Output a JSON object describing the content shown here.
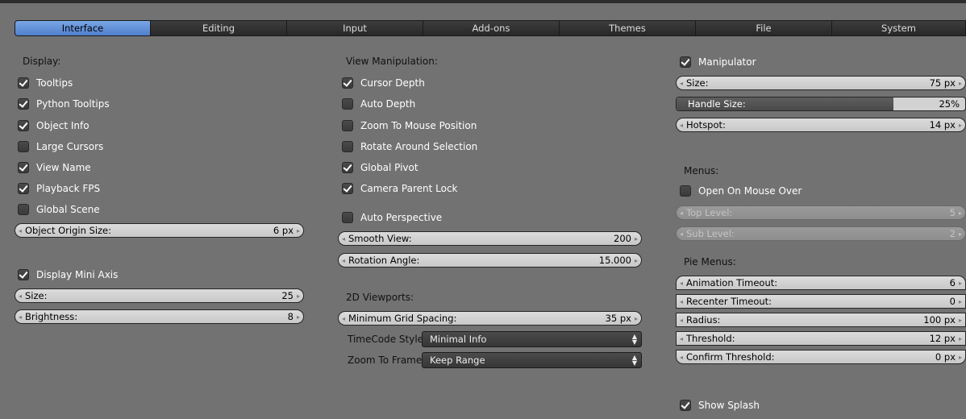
{
  "tabs": [
    "Interface",
    "Editing",
    "Input",
    "Add-ons",
    "Themes",
    "File",
    "System"
  ],
  "active_tab": "Interface",
  "col1": {
    "display_header": "Display:",
    "tooltips": "Tooltips",
    "python_tooltips": "Python Tooltips",
    "object_info": "Object Info",
    "large_cursors": "Large Cursors",
    "view_name": "View Name",
    "playback_fps": "Playback FPS",
    "global_scene": "Global Scene",
    "object_origin_size": {
      "label": "Object Origin Size:",
      "value": "6 px"
    },
    "display_mini_axis": "Display Mini Axis",
    "size": {
      "label": "Size:",
      "value": "25"
    },
    "brightness": {
      "label": "Brightness:",
      "value": "8"
    }
  },
  "col2": {
    "view_manip_header": "View Manipulation:",
    "cursor_depth": "Cursor Depth",
    "auto_depth": "Auto Depth",
    "zoom_to_mouse": "Zoom To Mouse Position",
    "rotate_around_selection": "Rotate Around Selection",
    "global_pivot": "Global Pivot",
    "camera_parent_lock": "Camera Parent Lock",
    "auto_perspective": "Auto Perspective",
    "smooth_view": {
      "label": "Smooth View:",
      "value": "200"
    },
    "rotation_angle": {
      "label": "Rotation Angle:",
      "value": "15.000"
    },
    "viewports_header": "2D Viewports:",
    "min_grid_spacing": {
      "label": "Minimum Grid Spacing:",
      "value": "35 px"
    },
    "timecode_label": "TimeCode Style:",
    "timecode_value": "Minimal Info",
    "zoom_frame_label": "Zoom To Frame ...",
    "zoom_frame_value": "Keep Range"
  },
  "col3": {
    "manipulator": "Manipulator",
    "size": {
      "label": "Size:",
      "value": "75 px"
    },
    "handle_size": {
      "label": "Handle Size:",
      "value": "25%",
      "fraction": 0.25
    },
    "hotspot": {
      "label": "Hotspot:",
      "value": "14 px"
    },
    "menus_header": "Menus:",
    "open_on_mouse_over": "Open On Mouse Over",
    "top_level": {
      "label": "Top Level:",
      "value": "5"
    },
    "sub_level": {
      "label": "Sub Level:",
      "value": "2"
    },
    "pie_header": "Pie Menus:",
    "animation_timeout": {
      "label": "Animation Timeout:",
      "value": "6"
    },
    "recenter_timeout": {
      "label": "Recenter Timeout:",
      "value": "0"
    },
    "radius": {
      "label": "Radius:",
      "value": "100 px"
    },
    "threshold": {
      "label": "Threshold:",
      "value": "12 px"
    },
    "confirm_threshold": {
      "label": "Confirm Threshold:",
      "value": "0 px"
    },
    "show_splash": "Show Splash"
  },
  "colors": {
    "background": "#727272",
    "tab_active": "#5b8bd6",
    "field": "#d0d0d0",
    "checkbox": "#444444"
  },
  "icons": {
    "arrow_left": "◂",
    "arrow_right": "▸",
    "check": "check-icon",
    "chevron": "updown-chevron-icon"
  }
}
